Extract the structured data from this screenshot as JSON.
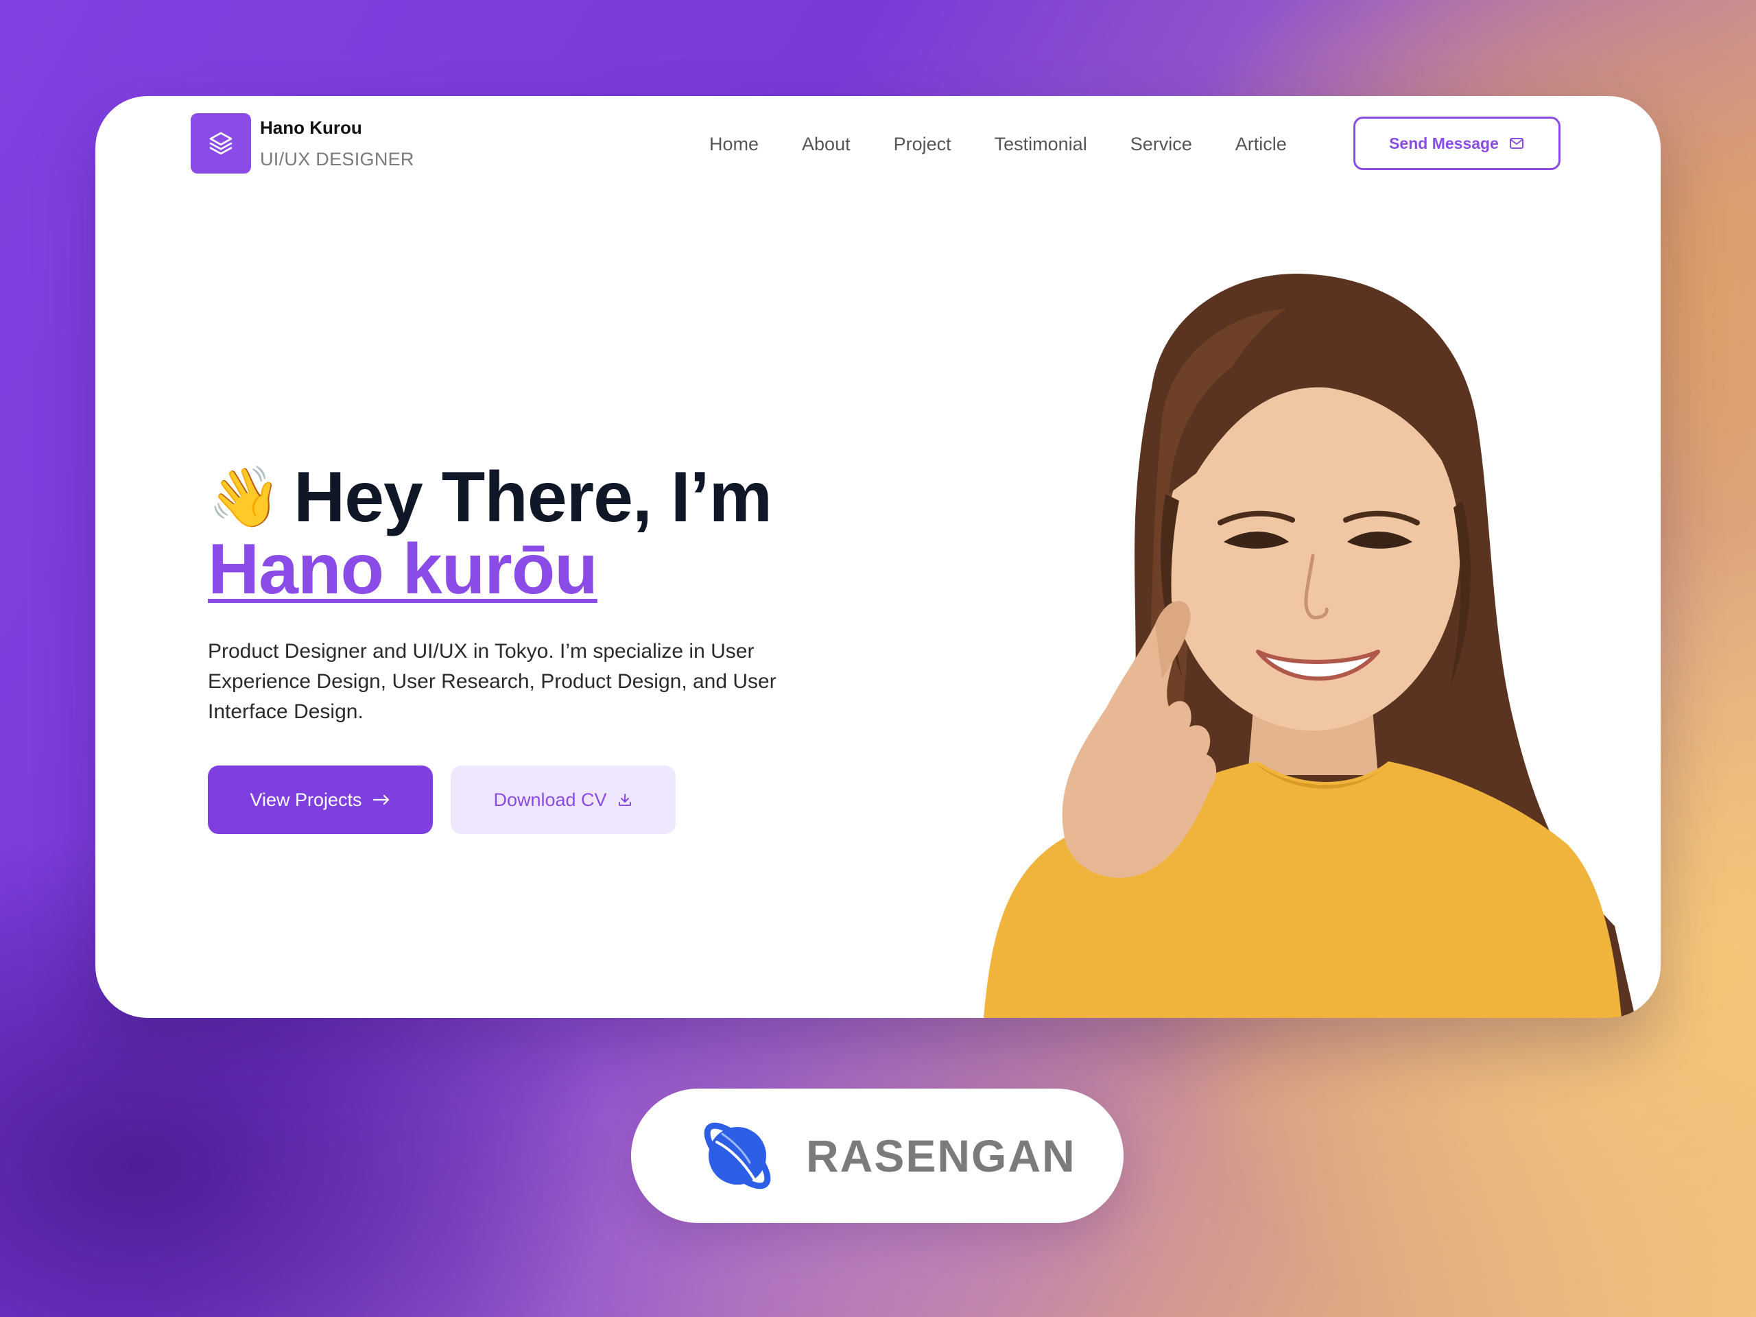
{
  "brand": {
    "name": "Hano Kurou",
    "role": "UI/UX DESIGNER",
    "logo_icon": "layers-icon"
  },
  "nav": {
    "items": [
      {
        "label": "Home"
      },
      {
        "label": "About"
      },
      {
        "label": "Project"
      },
      {
        "label": "Testimonial"
      },
      {
        "label": "Service"
      },
      {
        "label": "Article"
      }
    ],
    "send_button": {
      "label": "Send Message",
      "icon": "mail-icon"
    }
  },
  "hero": {
    "wave_emoji": "👋",
    "greeting": "Hey There, I’m",
    "name": "Hano kurōu",
    "description": "Product Designer and UI/UX in Tokyo. I’m specialize in User Experience Design, User Research, Product Design, and User Interface Design.",
    "primary_button": {
      "label": "View Projects",
      "icon": "arrow-right-icon"
    },
    "secondary_button": {
      "label": "Download CV",
      "icon": "download-icon"
    }
  },
  "badge": {
    "label": "RASENGAN",
    "icon": "rasengan-logo"
  },
  "colors": {
    "accent": "#8a4be6",
    "accent_light": "#efe7fd",
    "heading": "#101828",
    "sweater": "#f0b43c"
  }
}
